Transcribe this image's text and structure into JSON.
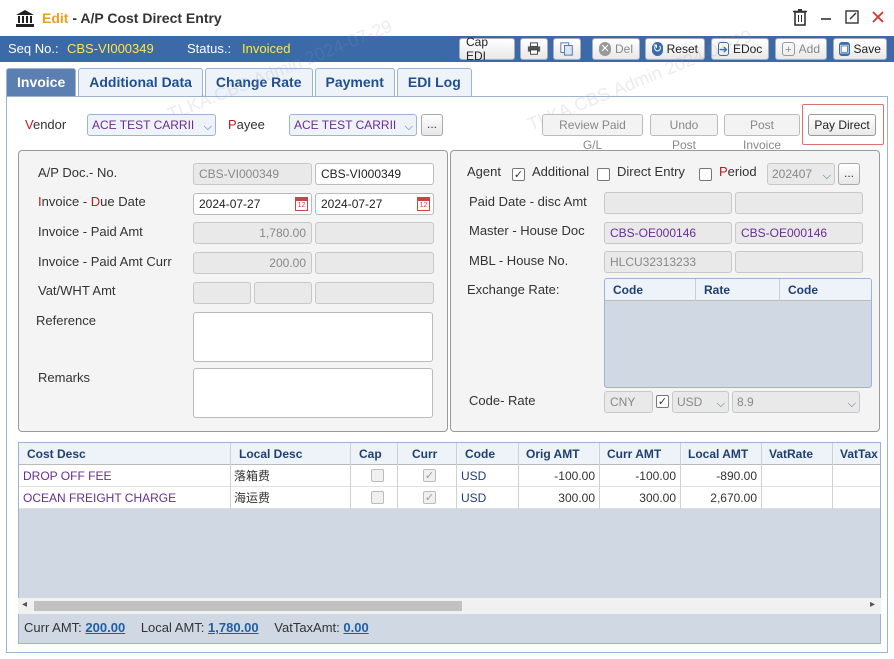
{
  "window": {
    "title_prefix": "Edit",
    "title_main": "- A/P Cost Direct Entry"
  },
  "toolbar": {
    "seq_label": "Seq No.:",
    "seq_value": "CBS-VI000349",
    "status_label": "Status.:",
    "status_value": "Invoiced",
    "buttons": {
      "cap_edi": "Cap EDI",
      "del": "Del",
      "reset": "Reset",
      "edoc": "EDoc",
      "add": "Add",
      "save": "Save"
    }
  },
  "tabs": [
    "Invoice",
    "Additional Data",
    "Change Rate",
    "Payment",
    "EDI Log"
  ],
  "header": {
    "vendor_label_first": "V",
    "vendor_label_rest": "endor",
    "vendor_value": "ACE TEST CARRII",
    "payee_label_first": "P",
    "payee_label_rest": "ayee",
    "payee_value": "ACE TEST CARRII",
    "ellipsis": "...",
    "actions": {
      "review": "Review Paid G/L",
      "undo": "Undo Post",
      "post": "Post Invoice",
      "pay": "Pay Direct"
    }
  },
  "left": {
    "doc_label": "A/P Doc.- No.",
    "doc_value_1": "CBS-VI000349",
    "doc_value_2": "CBS-VI000349",
    "invoice_date_label_a": "I",
    "invoice_date_label_b": "nvoice -",
    "invoice_date_label_c": "D",
    "invoice_date_label_d": "ue Date",
    "invoice_date": "2024-07-27",
    "due_date": "2024-07-27",
    "paid_amt_label": "Invoice - Paid Amt",
    "paid_amt": "1,780.00",
    "paid_amt_curr_label": "Invoice - Paid Amt Curr",
    "paid_amt_curr": "200.00",
    "vat_label": "Vat/WHT Amt",
    "reference_label": "Reference",
    "remarks_label": "Remarks",
    "cal_icon_text": "12"
  },
  "right": {
    "agent_label": "Agent",
    "additional_label": "Additional",
    "direct_entry_label": "Direct Entry",
    "period_label_first": "P",
    "period_label_rest": "eriod",
    "period_value": "202407",
    "paid_date_label": "Paid Date - disc Amt",
    "master_house_label": "Master - House Doc",
    "master_doc": "CBS-OE000146",
    "house_doc": "CBS-OE000146",
    "mbl_label": "MBL - House No.",
    "mbl_value": "HLCU32313233",
    "exchange_label": "Exchange Rate:",
    "exchange_cols": [
      "Code",
      "Rate",
      "Code"
    ],
    "code_rate_label": "Code- Rate",
    "code_from": "CNY",
    "code_to": "USD",
    "rate_value": "8.9",
    "checkmark": "✓"
  },
  "grid": {
    "columns": [
      "Cost Desc",
      "Local Desc",
      "Cap",
      "Curr",
      "Code",
      "Orig AMT",
      "Curr AMT",
      "Local AMT",
      "VatRate",
      "VatTax"
    ],
    "rows": [
      {
        "cost_desc": "DROP OFF FEE",
        "local_desc": "落箱费",
        "code": "USD",
        "orig": "-100.00",
        "curr": "-100.00",
        "local": "-890.00"
      },
      {
        "cost_desc": "OCEAN FREIGHT CHARGE",
        "local_desc": "海运费",
        "code": "USD",
        "orig": "300.00",
        "curr": "300.00",
        "local": "2,670.00"
      }
    ]
  },
  "footer": {
    "curr_label": "Curr AMT:",
    "curr_value": "200.00",
    "local_label": "Local AMT:",
    "local_value": "1,780.00",
    "vat_label": "VatTaxAmt:",
    "vat_value": "0.00"
  },
  "watermark": "TLKA.CBS.Admin 2024-07-29",
  "colors": {
    "accent": "#3c6aa8",
    "status_yellow": "#ffe64a",
    "required_red": "#c0181c",
    "purple_text": "#6a2d8f"
  }
}
